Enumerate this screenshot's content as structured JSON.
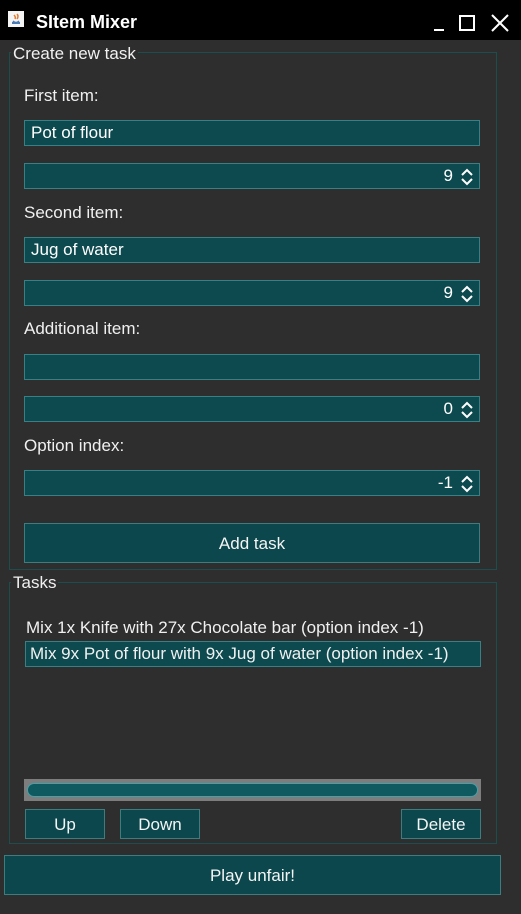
{
  "window": {
    "title": "SItem Mixer"
  },
  "create_group": {
    "title": "Create new task",
    "first_item": {
      "label": "First item:",
      "value": "Pot of flour",
      "amount": "9"
    },
    "second_item": {
      "label": "Second item:",
      "value": "Jug of water",
      "amount": "9"
    },
    "additional_item": {
      "label": "Additional item:",
      "value": "",
      "amount": "0"
    },
    "option_index": {
      "label": "Option index:",
      "value": "-1"
    },
    "add_button": "Add task"
  },
  "tasks_group": {
    "title": "Tasks",
    "items": [
      "Mix 1x Knife with 27x Chocolate bar (option index -1)",
      "Mix 9x Pot of flour with 9x Jug of water (option index -1)"
    ],
    "selected_index": 1,
    "up_button": "Up",
    "down_button": "Down",
    "delete_button": "Delete"
  },
  "play_button": "Play unfair!",
  "colors": {
    "field": "#0d4a4f",
    "border": "#3a7f83",
    "background": "#2e2e2e",
    "titlebar": "#000000"
  },
  "icons": [
    "java-app-icon",
    "minimize-icon",
    "maximize-icon",
    "close-icon",
    "spinner-arrows-icon"
  ]
}
